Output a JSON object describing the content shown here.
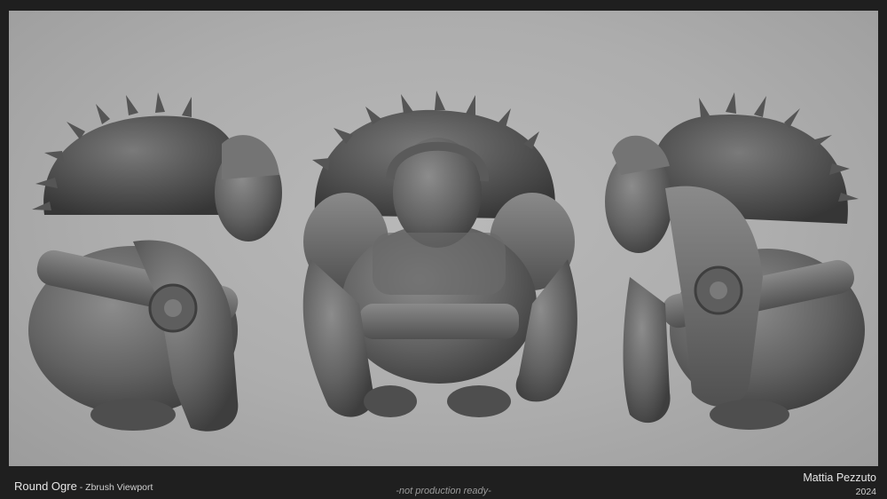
{
  "footer": {
    "title": "Round Ogre",
    "separator": " - ",
    "subtitle": "Zbrush Viewport",
    "note": "-not production ready-",
    "artist": "Mattia Pezzuto",
    "year": "2024"
  },
  "colors": {
    "background": "#1f1f1f",
    "viewport": "#adadad",
    "clay": "#6e6e6e",
    "text": "#e6e6e6"
  }
}
